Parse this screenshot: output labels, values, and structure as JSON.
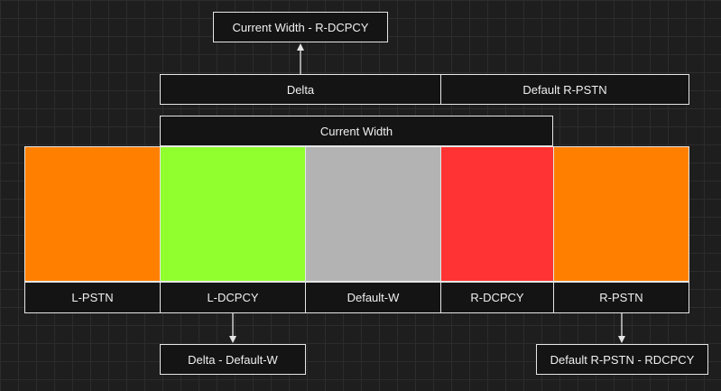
{
  "top_label": "Current Width - R-DCPCY",
  "row2": {
    "delta": "Delta",
    "default_rpstn": "Default R-PSTN"
  },
  "current_width": "Current Width",
  "segments": [
    {
      "label": "L-PSTN",
      "color": "#ff8000"
    },
    {
      "label": "L-DCPCY",
      "color": "#90ff2d"
    },
    {
      "label": "Default-W",
      "color": "#b3b3b3"
    },
    {
      "label": "R-DCPCY",
      "color": "#ff3333"
    },
    {
      "label": "R-PSTN",
      "color": "#ff8000"
    }
  ],
  "bottom_left": "Delta - Default-W",
  "bottom_right": "Default R-PSTN - RDCPCY"
}
